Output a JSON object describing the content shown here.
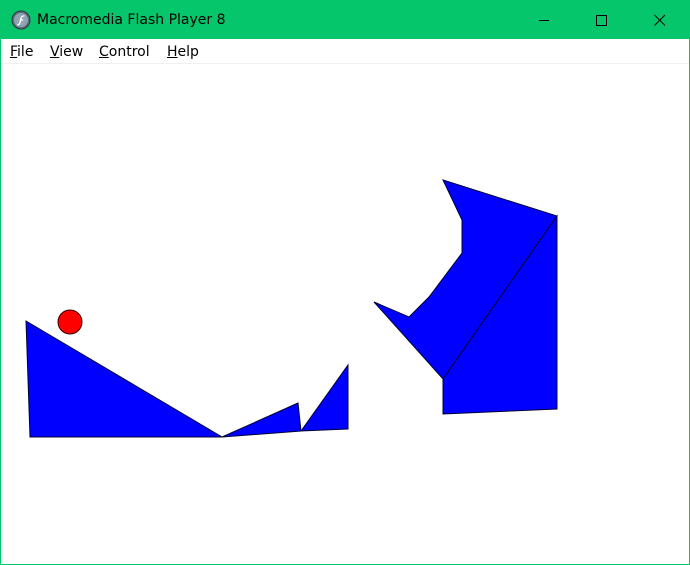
{
  "window": {
    "title": "Macromedia Flash Player 8",
    "app_icon": "flash-player-icon",
    "controls": [
      "minimize-icon",
      "maximize-icon",
      "close-icon"
    ]
  },
  "menu": {
    "file": "File",
    "view": "View",
    "control": "Control",
    "help": "Help"
  },
  "colors": {
    "titlebar": "#05c66a",
    "shape_fill": "#0000ff",
    "shape_stroke": "#000033",
    "ball_fill": "#ff0000"
  }
}
